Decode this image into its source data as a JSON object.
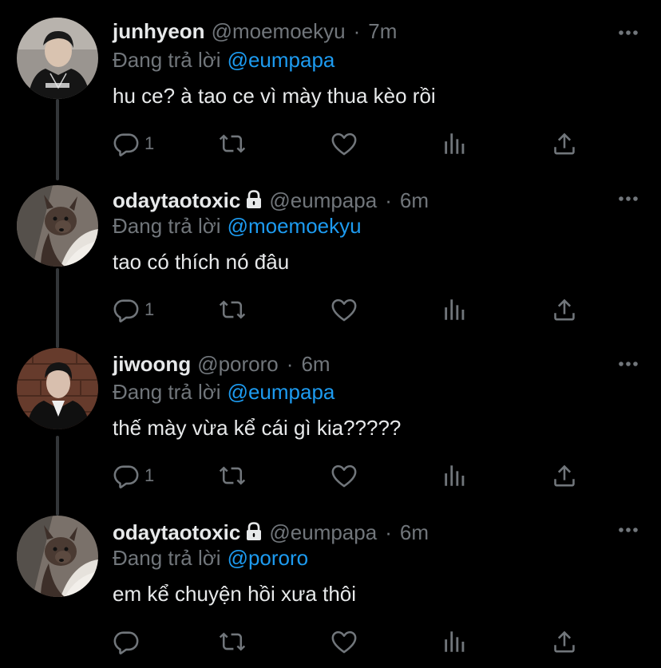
{
  "tweets": [
    {
      "display_name": "junhyeon",
      "handle": "@moemoekyu",
      "time": "7m",
      "locked": false,
      "reply_prefix": "Đang trả lời",
      "reply_to": "@eumpapa",
      "text": "hu ce? à tao ce vì mày thua kèo rồi",
      "reply_count": "1"
    },
    {
      "display_name": "odaytaotoxic",
      "handle": "@eumpapa",
      "time": "6m",
      "locked": true,
      "reply_prefix": "Đang trả lời",
      "reply_to": "@moemoekyu",
      "text": "tao có thích nó đâu",
      "reply_count": "1"
    },
    {
      "display_name": "jiwoong",
      "handle": "@pororo",
      "time": "6m",
      "locked": false,
      "reply_prefix": "Đang trả lời",
      "reply_to": "@eumpapa",
      "text": "thế mày vừa kể cái gì kia?????",
      "reply_count": "1"
    },
    {
      "display_name": "odaytaotoxic",
      "handle": "@eumpapa",
      "time": "6m",
      "locked": true,
      "reply_prefix": "Đang trả lời",
      "reply_to": "@pororo",
      "text": "em kể chuyện hồi xưa thôi",
      "reply_count": ""
    }
  ],
  "separator": "·",
  "icons": {
    "reply": "reply-icon",
    "retweet": "retweet-icon",
    "like": "heart-icon",
    "analytics": "analytics-icon",
    "share": "share-icon",
    "more": "more-icon",
    "lock": "lock-icon"
  },
  "colors": {
    "background": "#000000",
    "primary_text": "#e7e9ea",
    "secondary_text": "#71767b",
    "accent": "#1d9bf0",
    "thread_line": "#333639"
  }
}
